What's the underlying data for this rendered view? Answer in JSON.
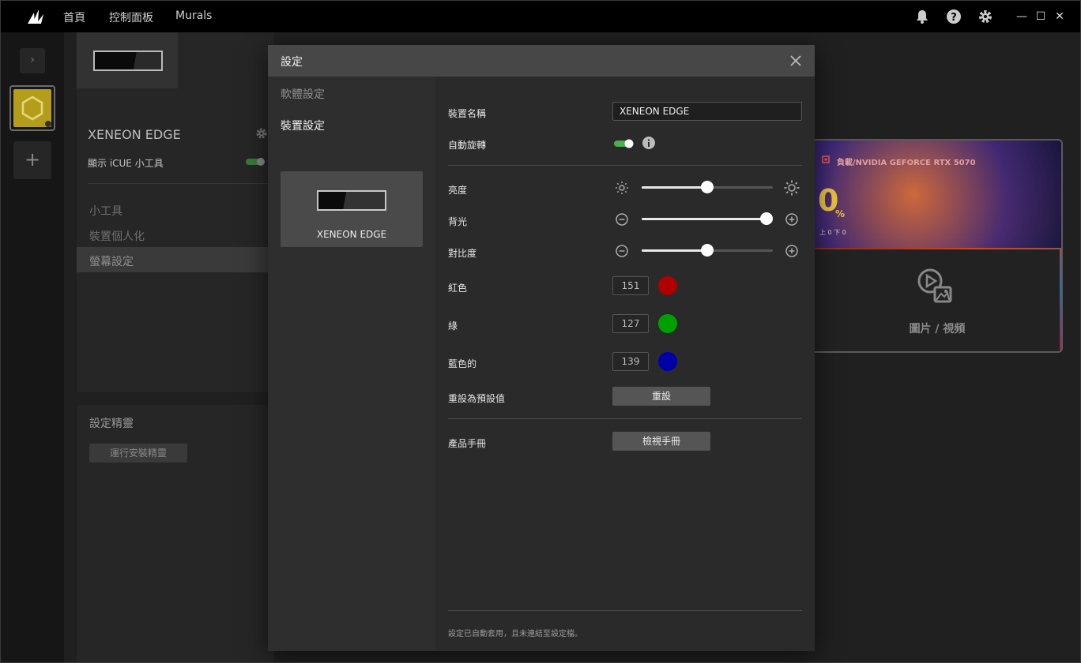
{
  "nav": {
    "home": "首頁",
    "dashboard": "控制面板",
    "murals": "Murals"
  },
  "icons": {
    "logo": "corsair-sails-icon",
    "bell": "bell-icon",
    "help": "help-icon",
    "settings": "gear-icon"
  },
  "window": {
    "minimize": "—",
    "maximize": "☐",
    "close": "✕"
  },
  "rail": {
    "collapse": "›",
    "add": "+"
  },
  "background": {
    "device_title": "XENEON EDGE",
    "show_widget": "顯示 iCUE 小工具",
    "menu": [
      "小工具",
      "裝置個人化",
      "螢幕設定"
    ],
    "wizard_title": "設定精靈",
    "wizard_button": "運行安裝精靈"
  },
  "preview": {
    "label": "負載/NVIDIA GEFORCE RTX 5070",
    "value": "0",
    "unit": "%",
    "sub": "上 0 下 0",
    "card_label": "圖片 / 視頻"
  },
  "modal": {
    "title": "設定",
    "side": {
      "software": "軟體設定",
      "device": "裝置設定",
      "device_card": "XENEON EDGE"
    },
    "fields": {
      "device_name_label": "裝置名稱",
      "device_name_value": "XENEON EDGE",
      "auto_rotate_label": "自動旋轉",
      "auto_rotate_on": true,
      "brightness_label": "亮度",
      "brightness": 0.5,
      "backlight_label": "背光",
      "backlight": 0.95,
      "contrast_label": "對比度",
      "contrast": 0.5,
      "red_label": "紅色",
      "red_value": "151",
      "red_color": "#b00000",
      "green_label": "綠",
      "green_value": "127",
      "green_color": "#00a000",
      "blue_label": "藍色的",
      "blue_value": "139",
      "blue_color": "#0000a8",
      "reset_label": "重設為預設值",
      "reset_button": "重設",
      "manual_label": "產品手冊",
      "manual_button": "檢視手冊"
    },
    "footer": "設定已自動套用，且未連結至設定檔。"
  },
  "colors": {
    "accent_green": "#4caf50",
    "slider_fill": "#e8e8e8"
  }
}
